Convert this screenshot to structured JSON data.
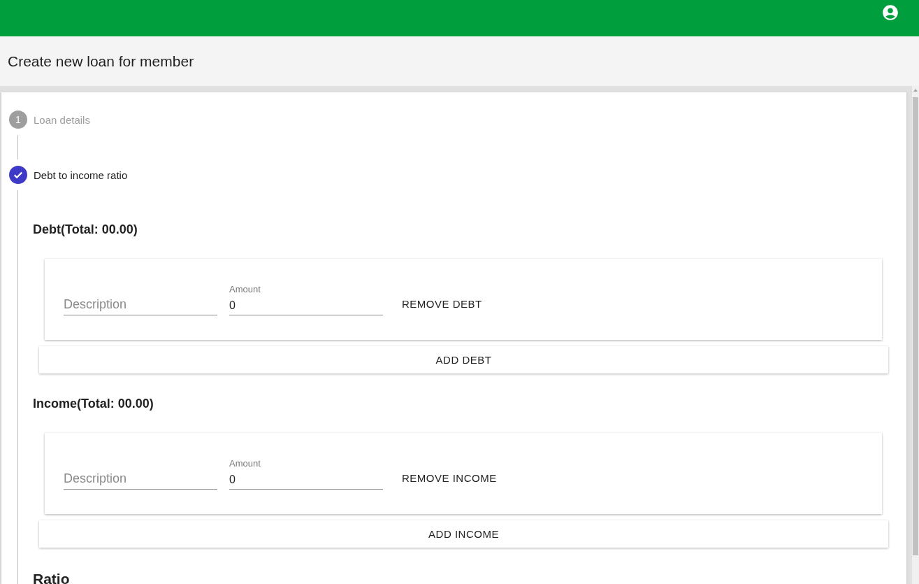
{
  "page_title": "Create new loan for member",
  "steps": [
    {
      "number": "1",
      "label": "Loan details",
      "completed": false,
      "active": false
    },
    {
      "label": "Debt to income ratio",
      "completed": true,
      "active": true
    }
  ],
  "sections": [
    {
      "heading": "Debt(Total: 00.00)",
      "entries": [
        {
          "description_placeholder": "Description",
          "amount_label": "Amount",
          "amount": "0",
          "remove_label": "REMOVE DEBT"
        }
      ],
      "add_label": "ADD DEBT"
    },
    {
      "heading": "Income(Total: 00.00)",
      "entries": [
        {
          "description_placeholder": "Description",
          "amount_label": "Amount",
          "amount": "0",
          "remove_label": "REMOVE INCOME"
        }
      ],
      "add_label": "ADD INCOME"
    }
  ],
  "ratio_heading": "Ratio"
}
